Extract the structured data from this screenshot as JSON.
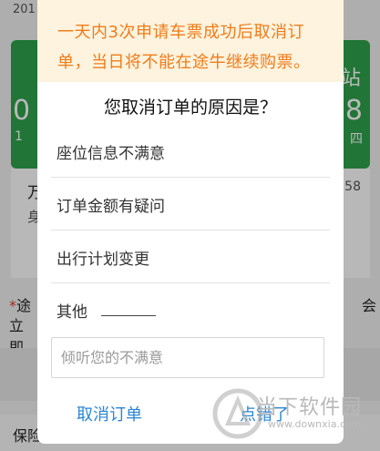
{
  "background": {
    "date_fragment": "201",
    "green_card": {
      "right_top": "站",
      "left_mid": "0",
      "right_mid": "8",
      "left_bottom": "1",
      "right_bottom": "四"
    },
    "white_card": {
      "left_top": "万",
      "right_top": "58",
      "left_bottom": "身"
    },
    "note_star": "*",
    "note_line1_left": "途",
    "note_line1_right": "会",
    "note_line2_left": "立即",
    "footer_text": "保险"
  },
  "dialog": {
    "warning_line1": "一天内3次申请车票成功后取消订",
    "warning_line2": "单，当日将不能在途牛继续购票。",
    "title": "您取消订单的原因是？",
    "reasons": [
      {
        "label": "座位信息不满意"
      },
      {
        "label": "订单金额有疑问"
      },
      {
        "label": "出行计划变更"
      },
      {
        "label": "其他"
      }
    ],
    "feedback_placeholder": "倾听您的不满意",
    "feedback_value": "",
    "cancel_order_label": "取消订单",
    "oops_label": "点错了"
  },
  "watermark": {
    "text": "当下软件园",
    "url": "www.downxia.com"
  }
}
